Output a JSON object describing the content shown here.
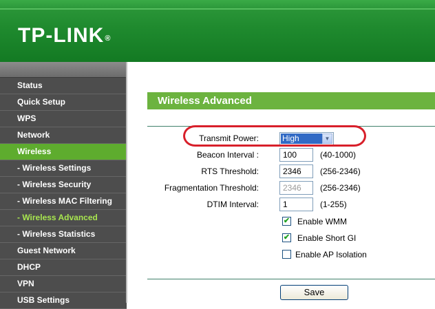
{
  "header": {
    "logo": "TP-LINK",
    "registered_mark": "®"
  },
  "sidebar": {
    "items": [
      {
        "label": "Status"
      },
      {
        "label": "Quick Setup"
      },
      {
        "label": "WPS"
      },
      {
        "label": "Network"
      },
      {
        "label": "Wireless"
      },
      {
        "label": "- Wireless Settings"
      },
      {
        "label": "- Wireless Security"
      },
      {
        "label": "- Wireless MAC Filtering"
      },
      {
        "label": "- Wireless Advanced"
      },
      {
        "label": "- Wireless Statistics"
      },
      {
        "label": "Guest Network"
      },
      {
        "label": "DHCP"
      },
      {
        "label": "VPN"
      },
      {
        "label": "USB Settings"
      }
    ]
  },
  "main": {
    "title": "Wireless Advanced",
    "transmit_power": {
      "label": "Transmit Power:",
      "value": "High",
      "arrow": "▼"
    },
    "beacon_interval": {
      "label": "Beacon Interval :",
      "value": "100",
      "range": "(40-1000)"
    },
    "rts_threshold": {
      "label": "RTS Threshold:",
      "value": "2346",
      "range": "(256-2346)"
    },
    "fragmentation_threshold": {
      "label": "Fragmentation Threshold:",
      "value": "2346",
      "range": "(256-2346)"
    },
    "dtim_interval": {
      "label": "DTIM Interval:",
      "value": "1",
      "range": "(1-255)"
    },
    "enable_wmm": {
      "label": "Enable WMM",
      "checked_glyph": "✔"
    },
    "enable_short_gi": {
      "label": "Enable Short GI",
      "checked_glyph": "✔"
    },
    "enable_ap_isolation": {
      "label": "Enable AP Isolation",
      "checked_glyph": ""
    },
    "save_label": "Save"
  },
  "colors": {
    "header_green": "#1f8a2e",
    "menu_active": "#5eac2e",
    "menu_current_text": "#a8e64f",
    "title_bar": "#6cb33f",
    "annotation_ring": "#d81f2a"
  }
}
